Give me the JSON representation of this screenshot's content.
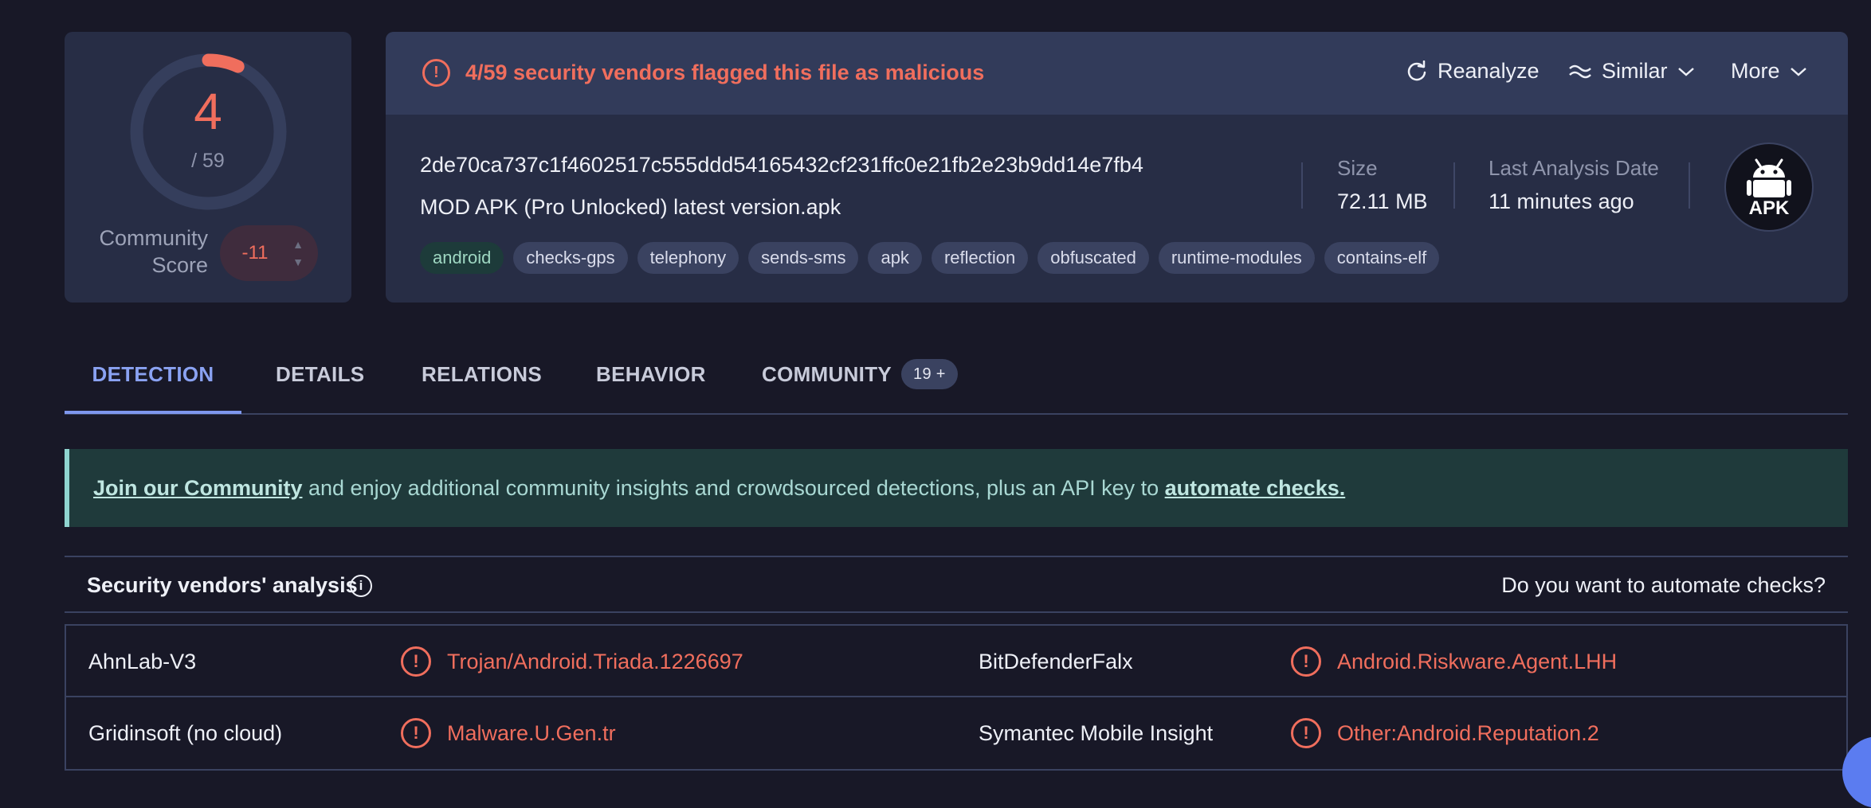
{
  "score": {
    "detections": "4",
    "total": "/ 59",
    "detected_fraction": 0.0678,
    "community_label_line1": "Community",
    "community_label_line2": "Score",
    "community_value": "-11"
  },
  "alert": {
    "text": "4/59 security vendors flagged this file as malicious"
  },
  "actions": {
    "reanalyze": "Reanalyze",
    "similar": "Similar",
    "more": "More"
  },
  "file": {
    "hash": "2de70ca737c1f4602517c555ddd54165432cf231ffc0e21fb2e23b9dd14e7fb4",
    "name": "MOD APK (Pro Unlocked) latest version.apk",
    "tags": [
      "android",
      "checks-gps",
      "telephony",
      "sends-sms",
      "apk",
      "reflection",
      "obfuscated",
      "runtime-modules",
      "contains-elf"
    ],
    "size_label": "Size",
    "size_value": "72.11 MB",
    "date_label": "Last Analysis Date",
    "date_value": "11 minutes ago",
    "type_icon_text": "APK"
  },
  "tabs": {
    "detection": "DETECTION",
    "details": "DETAILS",
    "relations": "RELATIONS",
    "behavior": "BEHAVIOR",
    "community": "COMMUNITY",
    "community_badge": "19 +"
  },
  "banner": {
    "link1": "Join our Community",
    "middle": " and enjoy additional community insights and crowdsourced detections, plus an API key to ",
    "link2": "automate checks."
  },
  "vendors": {
    "title": "Security vendors' analysis",
    "automate_question": "Do you want to automate checks?",
    "rows": [
      {
        "left_name": "AhnLab-V3",
        "left_result": "Trojan/Android.Triada.1226697",
        "right_name": "BitDefenderFalx",
        "right_result": "Android.Riskware.Agent.LHH"
      },
      {
        "left_name": "Gridinsoft (no cloud)",
        "left_result": "Malware.U.Gen.tr",
        "right_name": "Symantec Mobile Insight",
        "right_result": "Other:Android.Reputation.2"
      }
    ]
  },
  "colors": {
    "malicious": "#f06e5d",
    "accent": "#7e97ee",
    "banner_bg": "#1f3a3b"
  }
}
